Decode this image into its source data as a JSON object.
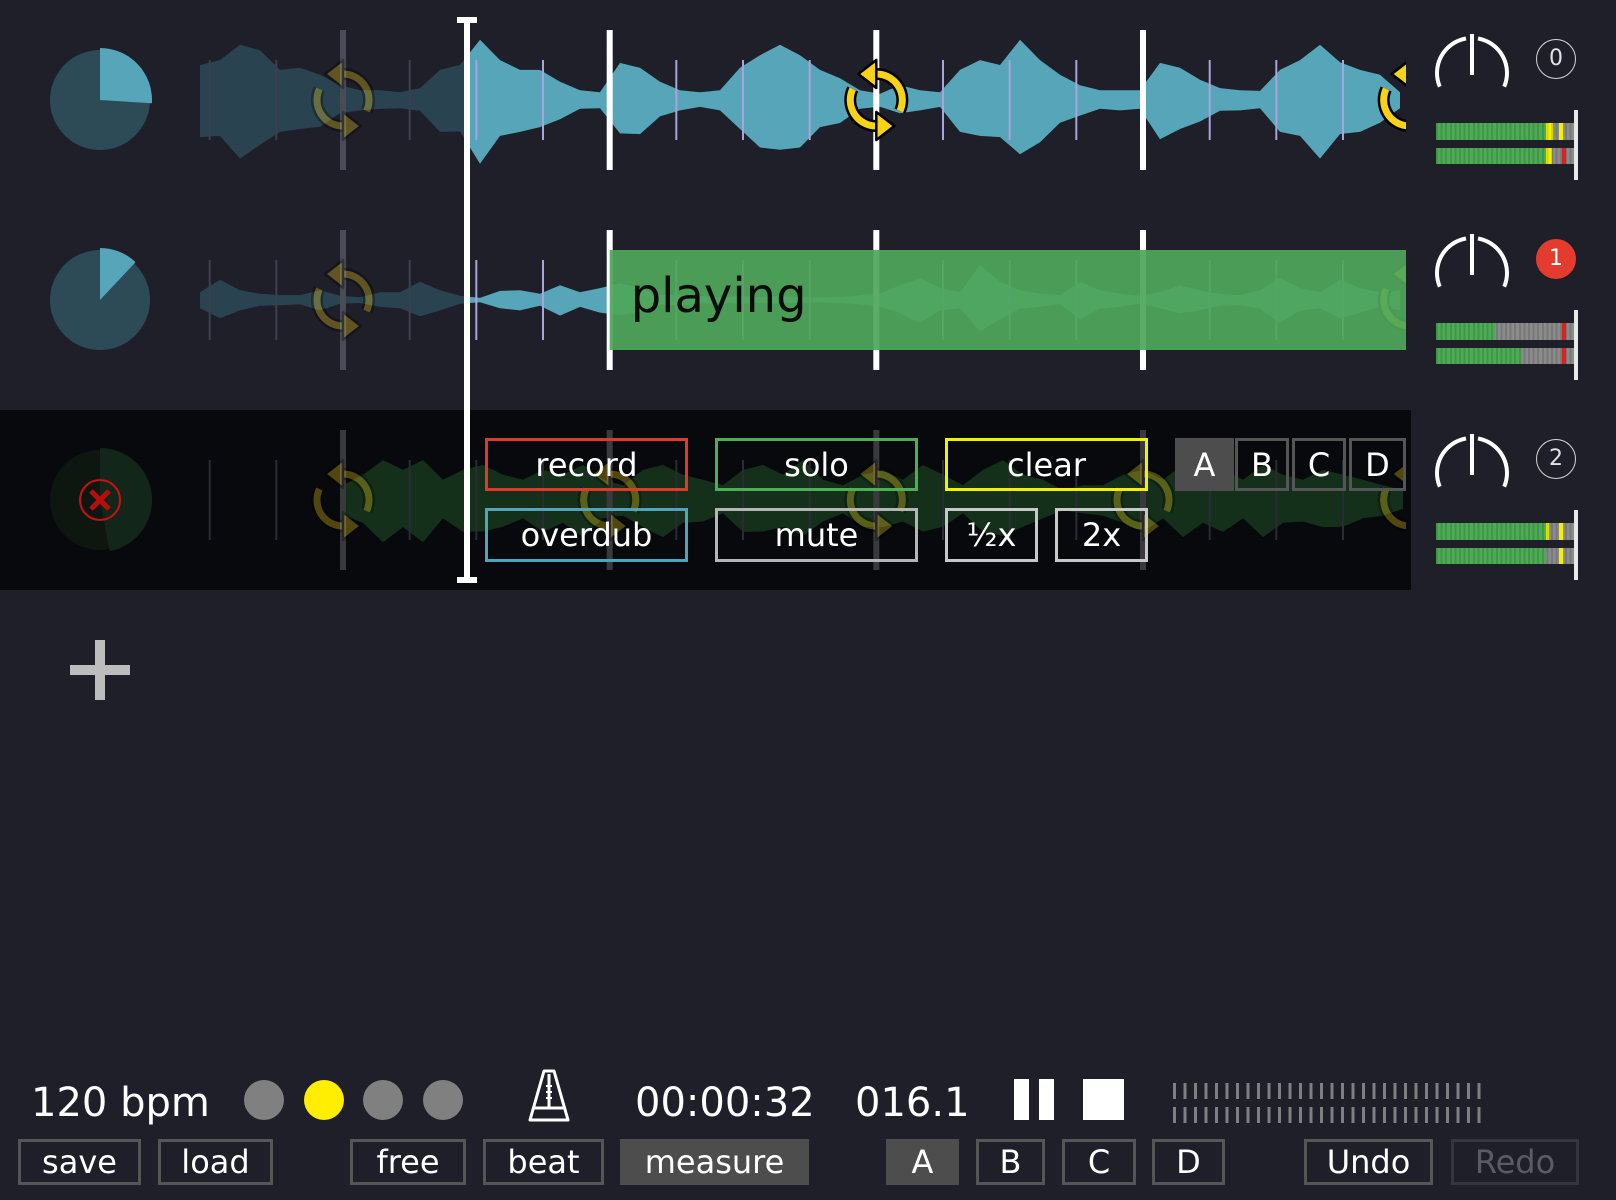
{
  "timeline": {
    "beats_per_measure": 4,
    "view_start_beat": -2.145,
    "view_end_beat": 15.945,
    "playhead_beat": 1.86
  },
  "colors": {
    "background": "#1e1f29",
    "wave_bright": "#56a5b8",
    "wave_dim": "#2a4350",
    "wave_selected": "#15301a",
    "loop": "#f7d215",
    "playing": "#4ea65a",
    "record": "#e0392b",
    "overdub": "#4fa3ba",
    "solo": "#4dae55",
    "mute": "#b5b5b5",
    "clear": "#f2f200",
    "rate": "#c8c8c8",
    "badge_active": "#e33b2e",
    "meter_green": "#4cab54",
    "meter_yellow": "#f2f200",
    "meter_red": "#e02020"
  },
  "tracks": [
    {
      "badge": "0",
      "badge_active": false,
      "progress": 0.26,
      "gain": 0.5,
      "selected": false,
      "error": false,
      "state_label": "",
      "state_start_beat": null,
      "loop_length_beats": 8,
      "wave_start_beat": -2.145,
      "wave_end_beat": 15.855,
      "waveform": [
        0.5,
        0.57,
        0.79,
        0.71,
        0.43,
        0.46,
        0.36,
        0.21,
        0.14,
        0.14,
        0.11,
        0.17,
        0.43,
        0.5,
        0.86,
        0.57,
        0.43,
        0.43,
        0.26,
        0.14,
        0.11,
        0.53,
        0.46,
        0.26,
        0.14,
        0.11,
        0.14,
        0.46,
        0.64,
        0.79,
        0.64,
        0.43,
        0.31,
        0.14,
        0.09,
        0.21,
        0.14,
        0.11,
        0.43,
        0.57,
        0.5,
        0.86,
        0.57,
        0.36,
        0.21,
        0.14,
        0.14,
        0.14,
        0.53,
        0.46,
        0.29,
        0.17,
        0.14,
        0.13,
        0.43,
        0.57,
        0.79,
        0.54,
        0.43,
        0.36,
        0.11
      ],
      "meters": [
        {
          "level": 0.85,
          "peak": 0.89
        },
        {
          "level": 0.84,
          "peak": 0.91
        }
      ]
    },
    {
      "badge": "1",
      "badge_active": true,
      "progress": 0.12,
      "gain": 0.5,
      "selected": false,
      "error": false,
      "state_label": "playing",
      "state_start_beat": 4,
      "loop_length_beats": 16,
      "wave_start_beat": -2.145,
      "wave_end_beat": 15.855,
      "waveform": [
        0.11,
        0.29,
        0.14,
        0.09,
        0.07,
        0.07,
        0.14,
        0.06,
        0.04,
        0.11,
        0.11,
        0.26,
        0.14,
        0.06,
        0.03,
        0.13,
        0.14,
        0.09,
        0.21,
        0.11,
        0.17,
        0.24,
        0.17,
        0.07,
        0.07,
        0.06,
        0.04,
        0.06,
        0.04,
        0.06,
        0.04,
        0.04,
        0.04,
        0.07,
        0.09,
        0.21,
        0.31,
        0.17,
        0.11,
        0.5,
        0.26,
        0.14,
        0.09,
        0.07,
        0.26,
        0.14,
        0.09,
        0.06,
        0.11,
        0.21,
        0.14,
        0.09,
        0.07,
        0.14,
        0.31,
        0.17,
        0.11,
        0.29,
        0.17,
        0.11,
        0.14
      ],
      "meters": [
        {
          "level": 0.43,
          "peak": 0.91
        },
        {
          "level": 0.62,
          "peak": 0.91
        }
      ]
    },
    {
      "badge": "2",
      "badge_active": false,
      "progress": 0.47,
      "gain": 0.5,
      "selected": true,
      "error": true,
      "state_label": "",
      "state_start_beat": null,
      "loop_length_beats": 4,
      "wave_start_beat": 0,
      "wave_end_beat": 15.9,
      "waveform": [
        0.21,
        0.36,
        0.57,
        0.43,
        0.57,
        0.29,
        0.43,
        0.5,
        0.36,
        0.29,
        0.43,
        0.36,
        0.5,
        0.29,
        0.21,
        0.43,
        0.5,
        0.36,
        0.29,
        0.21,
        0.43,
        0.5,
        0.36,
        0.57,
        0.29,
        0.21,
        0.36,
        0.43,
        0.29,
        0.5,
        0.36,
        0.21,
        0.43,
        0.57,
        0.36,
        0.29,
        0.14,
        0.21,
        0.21,
        0.36,
        0.43,
        0.29,
        0.5,
        0.36,
        0.43,
        0.29,
        0.5,
        0.36,
        0.29,
        0.43,
        0.36,
        0.29,
        0.21,
        0.14
      ],
      "meters": [
        {
          "level": 0.82,
          "peak": 0.89
        },
        {
          "level": 0.8,
          "peak": 0.89
        }
      ]
    }
  ],
  "track_menu": {
    "record": "record",
    "overdub": "overdub",
    "solo": "solo",
    "mute": "mute",
    "clear": "clear",
    "half_speed": "½x",
    "double_speed": "2x",
    "scenes": [
      {
        "label": "A",
        "active": true
      },
      {
        "label": "B",
        "active": false
      },
      {
        "label": "C",
        "active": false
      },
      {
        "label": "D",
        "active": false
      }
    ]
  },
  "add_track": {
    "icon": "plus-icon"
  },
  "transport": {
    "tempo": "120 bpm",
    "beat_dots": [
      false,
      true,
      false,
      false
    ],
    "metronome_icon": "metronome-icon",
    "time": "00:00:32",
    "position": "016.1",
    "pause_icon": "pause-icon",
    "stop_icon": "stop-icon",
    "input_meter": {
      "left": 0,
      "right": 0
    }
  },
  "toolbar": {
    "save": "save",
    "load": "load",
    "quantize": [
      {
        "label": "free",
        "active": false
      },
      {
        "label": "beat",
        "active": false
      },
      {
        "label": "measure",
        "active": true
      }
    ],
    "scenes": [
      {
        "label": "A",
        "active": true
      },
      {
        "label": "B",
        "active": false
      },
      {
        "label": "C",
        "active": false
      },
      {
        "label": "D",
        "active": false
      }
    ],
    "undo": {
      "label": "Undo",
      "enabled": true
    },
    "redo": {
      "label": "Redo",
      "enabled": false
    }
  }
}
